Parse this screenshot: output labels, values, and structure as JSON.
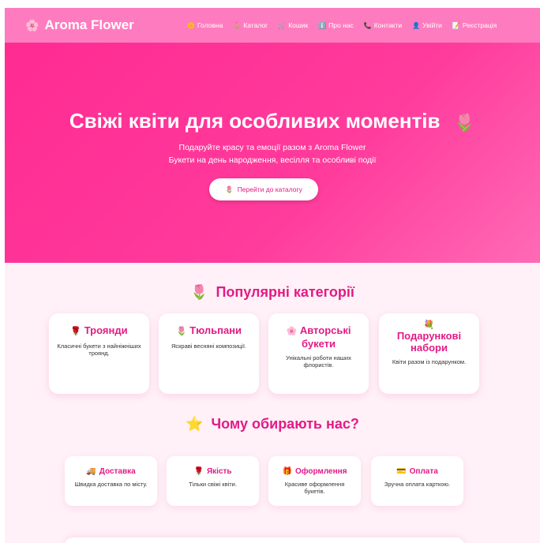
{
  "header": {
    "logo_icon": "🌸",
    "logo_text": "Aroma Flower",
    "nav": [
      {
        "icon": "🌼",
        "label": "Головна"
      },
      {
        "icon": "🌷",
        "label": "Каталог"
      },
      {
        "icon": "🛒",
        "label": "Кошик"
      },
      {
        "icon": "ℹ️",
        "label": "Про нас"
      },
      {
        "icon": "📞",
        "label": "Контакти"
      },
      {
        "icon": "👤",
        "label": "Увійти"
      },
      {
        "icon": "📝",
        "label": "Реєстрація"
      }
    ]
  },
  "hero": {
    "title": "Свіжі квіти для особливих моментів",
    "title_icon": "🌷",
    "subtitle_1": "Подаруйте красу та емоції разом з Aroma Flower",
    "subtitle_2": "Букети на день народження, весілля та особливі події",
    "button_icon": "🌷",
    "button_label": "Перейти до каталогу"
  },
  "categories": {
    "icon": "🌷",
    "title": "Популярні категорії",
    "items": [
      {
        "icon": "🌹",
        "title": "Троянди",
        "desc": "Класичні букети з найніжніших троянд."
      },
      {
        "icon": "🌷",
        "title": "Тюльпани",
        "desc": "Яскраві весняні композиції."
      },
      {
        "icon": "🌸",
        "title": "Авторські букети",
        "desc": "Унікальні роботи наших флористів."
      },
      {
        "icon": "💐",
        "title": "Подарункові набори",
        "desc": "Квіти разом із подарунком."
      }
    ]
  },
  "why": {
    "icon": "⭐",
    "title": "Чому обирають нас?",
    "items": [
      {
        "icon": "🚚",
        "title": "Доставка",
        "desc": "Швидка доставка по місту."
      },
      {
        "icon": "🌹",
        "title": "Якість",
        "desc": "Тільки свіжі квіти."
      },
      {
        "icon": "🎁",
        "title": "Оформлення",
        "desc": "Красиве оформлення букетів."
      },
      {
        "icon": "💳",
        "title": "Оплата",
        "desc": "Зручна оплата карткою."
      }
    ]
  },
  "colors": {
    "header_bg": "#ff7bbf",
    "hero_bg": "#ff2b92",
    "accent": "#e21b86",
    "page_bg": "#fff1f7"
  }
}
